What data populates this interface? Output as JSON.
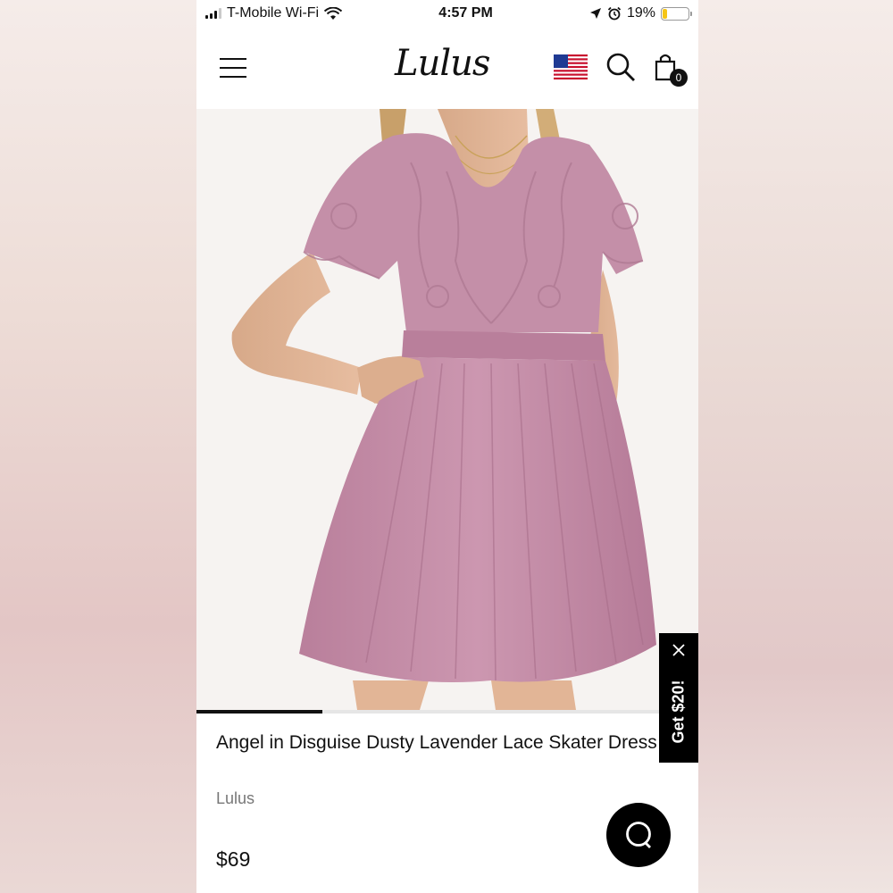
{
  "status_bar": {
    "carrier": "T-Mobile Wi-Fi",
    "time": "4:57 PM",
    "battery_percent": "19%",
    "battery_level": 0.19
  },
  "header": {
    "logo": "Lulus",
    "cart_count": "0",
    "icons": [
      "menu-icon",
      "us-flag-icon",
      "search-icon",
      "shopping-bag-icon"
    ]
  },
  "product": {
    "title": "Angel in Disguise Dusty Lavender Lace Skater Dress",
    "brand": "Lulus",
    "price": "$69",
    "image_alt": "Dusty lavender lace skater dress",
    "carousel_position": 0.25
  },
  "promo": {
    "label": "Get $20!"
  },
  "colors": {
    "dress": "#c58fa8",
    "accent": "#000000",
    "battery": "#f5c518"
  }
}
